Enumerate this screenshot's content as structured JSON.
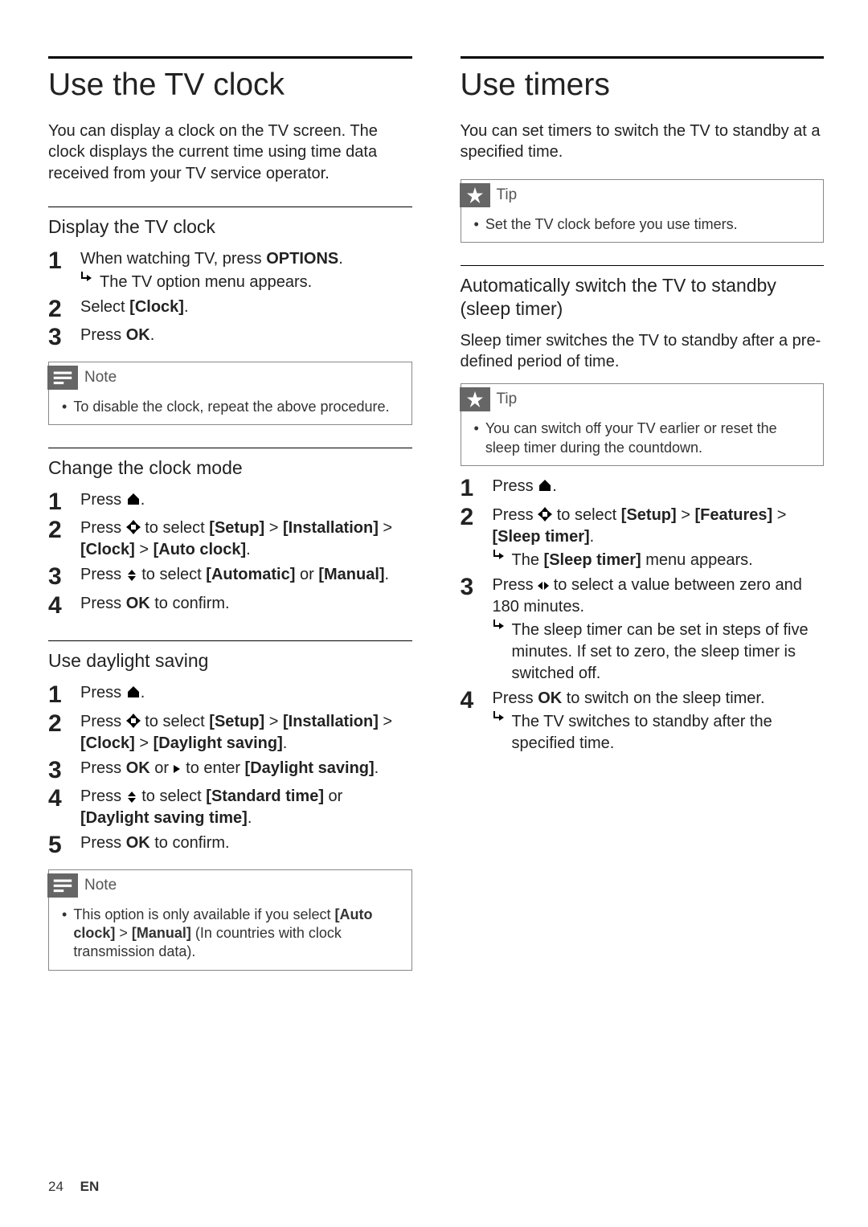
{
  "left": {
    "h1": "Use the TV clock",
    "intro": "You can display a clock on the TV screen. The clock displays the current time using time data received from your TV service operator.",
    "s1": {
      "h2": "Display the TV clock",
      "step1a": "When watching TV, press ",
      "step1b": "OPTIONS",
      "step1c": ".",
      "step1_sub": "The TV option menu appears.",
      "step2a": "Select ",
      "step2b": "[Clock]",
      "step2c": ".",
      "step3a": "Press ",
      "step3b": "OK",
      "step3c": "."
    },
    "note1_label": "Note",
    "note1_body": "To disable the clock, repeat the above procedure.",
    "s2": {
      "h2": "Change the clock mode",
      "step1": "Press ",
      "step1_end": ".",
      "step2a": "Press ",
      "step2b": " to select ",
      "step2c": "[Setup]",
      "step2d": " > ",
      "step2e": "[Installation]",
      "step2f": " > ",
      "step2g": "[Clock]",
      "step2h": " > ",
      "step2i": "[Auto clock]",
      "step2j": ".",
      "step3a": "Press ",
      "step3b": " to select ",
      "step3c": "[Automatic]",
      "step3d": " or ",
      "step3e": "[Manual]",
      "step3f": ".",
      "step4a": "Press ",
      "step4b": "OK",
      "step4c": " to confirm."
    },
    "s3": {
      "h2": "Use daylight saving",
      "step1": "Press ",
      "step1_end": ".",
      "step2a": "Press ",
      "step2b": " to select ",
      "step2c": "[Setup]",
      "step2d": " > ",
      "step2e": "[Installation]",
      "step2f": " > ",
      "step2g": "[Clock]",
      "step2h": " > ",
      "step2i": "[Daylight saving]",
      "step2j": ".",
      "step3a": "Press ",
      "step3b": "OK",
      "step3c": " or ",
      "step3d": " to enter ",
      "step3e": "[Daylight saving]",
      "step3f": ".",
      "step4a": "Press ",
      "step4b": " to select ",
      "step4c": "[Standard time]",
      "step4d": " or ",
      "step4e": "[Daylight saving time]",
      "step4f": ".",
      "step5a": "Press ",
      "step5b": "OK",
      "step5c": " to confirm."
    },
    "note2_label": "Note",
    "note2_body_a": "This option is only available if you select ",
    "note2_body_b": "[Auto clock]",
    "note2_body_c": " > ",
    "note2_body_d": "[Manual]",
    "note2_body_e": " (In countries with clock transmission data)."
  },
  "right": {
    "h1": "Use timers",
    "intro": "You can set timers to switch the TV to standby at a specified time.",
    "tip1_label": "Tip",
    "tip1_body": "Set the TV clock before you use timers.",
    "s1": {
      "h2": "Automatically switch the TV to standby (sleep timer)",
      "intro": "Sleep timer switches the TV to standby after a pre-defined period of time."
    },
    "tip2_label": "Tip",
    "tip2_body": "You can switch off your TV earlier or reset the sleep timer during the countdown.",
    "steps": {
      "step1": "Press ",
      "step1_end": ".",
      "step2a": "Press ",
      "step2b": " to select ",
      "step2c": "[Setup]",
      "step2d": " > ",
      "step2e": "[Features]",
      "step2f": " > ",
      "step2g": "[Sleep timer]",
      "step2h": ".",
      "step2_sub_a": "The ",
      "step2_sub_b": "[Sleep timer]",
      "step2_sub_c": " menu appears.",
      "step3a": "Press ",
      "step3b": " to select a value between zero and 180 minutes.",
      "step3_sub": "The sleep timer can be set in steps of five minutes. If set to zero, the sleep timer is switched off.",
      "step4a": "Press ",
      "step4b": "OK",
      "step4c": " to switch on the sleep timer.",
      "step4_sub": "The TV switches to standby after the specified time."
    }
  },
  "footer": {
    "page": "24",
    "lang": "EN"
  }
}
